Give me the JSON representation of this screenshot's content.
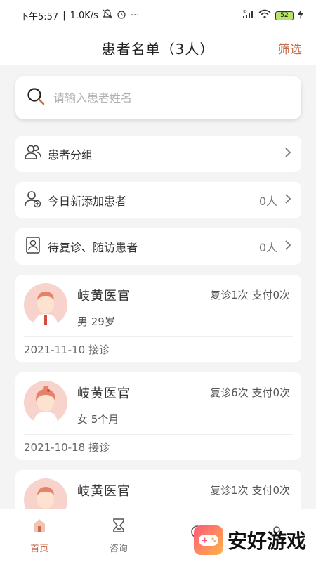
{
  "status_bar": {
    "time": "下午5:57",
    "speed": "1.0K/s",
    "more": "···",
    "network": "HD",
    "battery": "52"
  },
  "nav": {
    "title": "患者名单（3人）",
    "filter": "筛选"
  },
  "search": {
    "placeholder": "请输入患者姓名",
    "value": ""
  },
  "menu": [
    {
      "label": "患者分组",
      "count": ""
    },
    {
      "label": "今日新添加患者",
      "count": "0人"
    },
    {
      "label": "待复诊、随访患者",
      "count": "0人"
    }
  ],
  "patients": [
    {
      "name": "岐黄医官",
      "stats": "复诊1次  支付0次",
      "info": "男 29岁",
      "date": "2021-11-10  接诊",
      "gender": "male"
    },
    {
      "name": "岐黄医官",
      "stats": "复诊6次  支付0次",
      "info": "女 5个月",
      "date": "2021-10-18  接诊",
      "gender": "female"
    },
    {
      "name": "岐黄医官",
      "stats": "复诊1次  支付0次",
      "info": "",
      "date": "",
      "gender": "male"
    }
  ],
  "tabs": [
    {
      "label": "首页",
      "icon": "home-icon",
      "active": true
    },
    {
      "label": "咨询",
      "icon": "consult-icon",
      "active": false
    },
    {
      "label": "",
      "icon": "message-icon",
      "active": false
    },
    {
      "label": "",
      "icon": "profile-icon",
      "active": false
    }
  ],
  "watermark": {
    "text": "安好游戏"
  },
  "colors": {
    "accent": "#c76b4a",
    "avatar_bg": "#f7d3cc"
  }
}
